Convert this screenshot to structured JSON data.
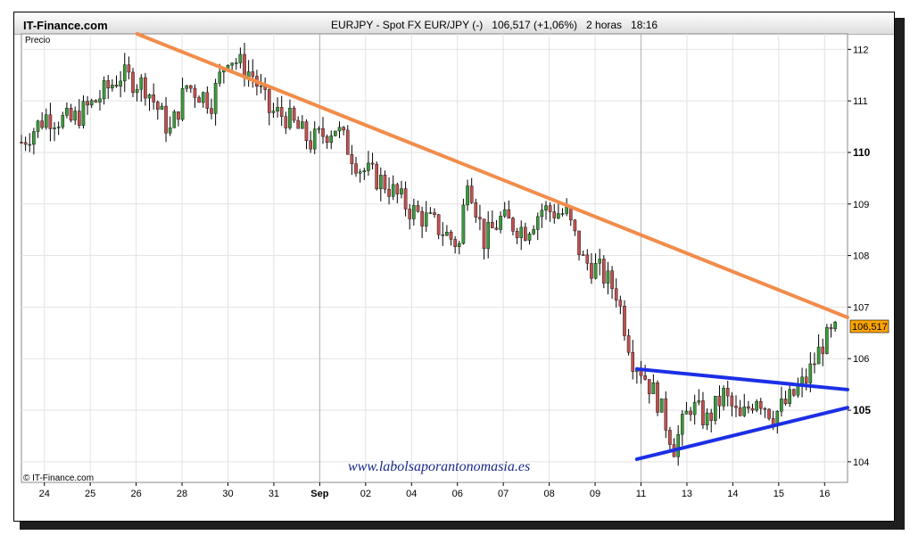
{
  "header": {
    "brand": "IT-Finance.com",
    "instrument": "EURJPY - Spot FX EUR/JPY (-)",
    "quote": "106,517 (+1,06%)",
    "interval": "2 horas",
    "time": "18:16"
  },
  "panel_label": "Precio",
  "footer_brand": "© IT-Finance.com",
  "watermark": "www.labolsaporantonomasia.es",
  "price_badge": "106,517",
  "colors": {
    "up": "#3c9a3c",
    "down": "#c25050",
    "resistance": "#f28c4a",
    "triangle": "#1c2fe6",
    "badge": "#ffa500"
  },
  "chart_data": {
    "type": "candlestick",
    "title": "EURJPY - Spot FX EUR/JPY (-)",
    "ylabel": "Precio",
    "ylim": [
      103.6,
      112.3
    ],
    "yticks": [
      104,
      105,
      106,
      107,
      108,
      109,
      110,
      111,
      112
    ],
    "xticks": [
      "24",
      "25",
      "26",
      "28",
      "30",
      "31",
      "Sep",
      "02",
      "04",
      "06",
      "07",
      "08",
      "09",
      "11",
      "13",
      "14",
      "15",
      "16"
    ],
    "last_price": 106.517,
    "change_pct": 1.06,
    "close_path": [
      {
        "x": 0,
        "y": 110.2
      },
      {
        "x": 3,
        "y": 110.7
      },
      {
        "x": 6,
        "y": 110.6
      },
      {
        "x": 9,
        "y": 111.0
      },
      {
        "x": 12,
        "y": 111.5
      },
      {
        "x": 15,
        "y": 111.3
      },
      {
        "x": 18,
        "y": 110.4
      },
      {
        "x": 20,
        "y": 111.3
      },
      {
        "x": 23,
        "y": 111.0
      },
      {
        "x": 25,
        "y": 111.9
      },
      {
        "x": 28,
        "y": 111.5
      },
      {
        "x": 30,
        "y": 110.8
      },
      {
        "x": 32,
        "y": 110.7
      },
      {
        "x": 35,
        "y": 110.2
      },
      {
        "x": 38,
        "y": 110.5
      },
      {
        "x": 41,
        "y": 109.7
      },
      {
        "x": 44,
        "y": 109.4
      },
      {
        "x": 47,
        "y": 108.9
      },
      {
        "x": 50,
        "y": 108.6
      },
      {
        "x": 53,
        "y": 108.2
      },
      {
        "x": 54,
        "y": 109.6
      },
      {
        "x": 56,
        "y": 108.3
      },
      {
        "x": 58,
        "y": 108.7
      },
      {
        "x": 61,
        "y": 108.5
      },
      {
        "x": 63,
        "y": 108.9
      },
      {
        "x": 66,
        "y": 108.8
      },
      {
        "x": 68,
        "y": 107.9
      },
      {
        "x": 70,
        "y": 107.7
      },
      {
        "x": 72,
        "y": 107.3
      },
      {
        "x": 74,
        "y": 106.0
      },
      {
        "x": 75,
        "y": 105.8
      },
      {
        "x": 77,
        "y": 105.2
      },
      {
        "x": 79,
        "y": 104.3
      },
      {
        "x": 81,
        "y": 105.1
      },
      {
        "x": 83,
        "y": 104.8
      },
      {
        "x": 85,
        "y": 105.3
      },
      {
        "x": 87,
        "y": 104.8
      },
      {
        "x": 89,
        "y": 105.3
      },
      {
        "x": 91,
        "y": 104.9
      },
      {
        "x": 93,
        "y": 105.2
      },
      {
        "x": 95,
        "y": 105.6
      },
      {
        "x": 97,
        "y": 106.3
      },
      {
        "x": 98.5,
        "y": 106.5
      }
    ],
    "trendlines": [
      {
        "name": "",
        "color": "#f28c4a",
        "points": [
          {
            "x": 14,
            "y": 112.3
          },
          {
            "x": 100,
            "y": 106.8
          }
        ]
      },
      {
        "name": "",
        "color": "#1c2fe6",
        "points": [
          {
            "x": 74.5,
            "y": 105.8
          },
          {
            "x": 100,
            "y": 105.4
          }
        ]
      },
      {
        "name": "",
        "color": "#1c2fe6",
        "points": [
          {
            "x": 74.5,
            "y": 104.05
          },
          {
            "x": 100,
            "y": 105.05
          }
        ]
      }
    ]
  }
}
